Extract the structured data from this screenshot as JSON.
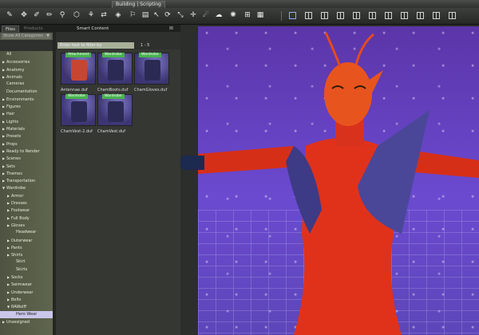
{
  "window": {
    "mode_tab": "Building | Scripting"
  },
  "toolbar": {
    "icons": [
      "pose-tool-icon",
      "universal-tool-icon",
      "node-weight-brush-icon",
      "edit-tool-icon",
      "active-pose-icon",
      "geometry-editor-icon",
      "joint-editor-icon",
      "transfer-icon",
      "surface-selection-icon",
      "region-navigator-icon",
      "script-icon",
      "pointer-icon",
      "rotate-icon",
      "scale-icon",
      "translate-icon",
      "camera-icon",
      "render-icon",
      "lights-icon",
      "aux-viewport-icon",
      "grid-icon"
    ],
    "viewport_layout_buttons": 11
  },
  "left_pane": {
    "tabs": {
      "files": "Files",
      "products": "Products",
      "smart_content": "Smart Content"
    },
    "category_select": "Show All Categories",
    "filter_placeholder": "Enter text to filter by",
    "result_count": "1 - 5",
    "categories": [
      {
        "label": "All",
        "indent": 0,
        "tri": ""
      },
      {
        "label": "Accessories",
        "indent": 0,
        "tri": "▶"
      },
      {
        "label": "Anatomy",
        "indent": 0,
        "tri": "▶"
      },
      {
        "label": "Animals",
        "indent": 0,
        "tri": "▶"
      },
      {
        "label": "Cameras",
        "indent": 0,
        "tri": ""
      },
      {
        "label": "Documentation",
        "indent": 0,
        "tri": ""
      },
      {
        "label": "Environments",
        "indent": 0,
        "tri": "▶"
      },
      {
        "label": "Figures",
        "indent": 0,
        "tri": "▶"
      },
      {
        "label": "Hair",
        "indent": 0,
        "tri": "▶"
      },
      {
        "label": "Lights",
        "indent": 0,
        "tri": "▶"
      },
      {
        "label": "Materials",
        "indent": 0,
        "tri": "▶"
      },
      {
        "label": "Presets",
        "indent": 0,
        "tri": "▶"
      },
      {
        "label": "Props",
        "indent": 0,
        "tri": "▶"
      },
      {
        "label": "Ready to Render",
        "indent": 0,
        "tri": "▶"
      },
      {
        "label": "Scenes",
        "indent": 0,
        "tri": "▶"
      },
      {
        "label": "Sets",
        "indent": 0,
        "tri": "▶"
      },
      {
        "label": "Themes",
        "indent": 0,
        "tri": "▶"
      },
      {
        "label": "Transportation",
        "indent": 0,
        "tri": "▶"
      },
      {
        "label": "Wardrobe",
        "indent": 0,
        "tri": "▼"
      },
      {
        "label": "Armor",
        "indent": 1,
        "tri": "▶"
      },
      {
        "label": "Dresses",
        "indent": 1,
        "tri": "▶"
      },
      {
        "label": "Footwear",
        "indent": 1,
        "tri": "▶"
      },
      {
        "label": "Full Body",
        "indent": 1,
        "tri": "▶"
      },
      {
        "label": "Gloves",
        "indent": 1,
        "tri": "▶"
      },
      {
        "label": "Headwear",
        "indent": 2,
        "tri": ""
      },
      {
        "label": "Outerwear",
        "indent": 1,
        "tri": "▶"
      },
      {
        "label": "Pants",
        "indent": 1,
        "tri": "▶"
      },
      {
        "label": "Shirts",
        "indent": 1,
        "tri": "▶"
      },
      {
        "label": "Skirt",
        "indent": 2,
        "tri": ""
      },
      {
        "label": "Skirts",
        "indent": 2,
        "tri": ""
      },
      {
        "label": "Socks",
        "indent": 1,
        "tri": "▶"
      },
      {
        "label": "Swimwear",
        "indent": 1,
        "tri": "▶"
      },
      {
        "label": "Underwear",
        "indent": 1,
        "tri": "▶"
      },
      {
        "label": "Belts",
        "indent": 1,
        "tri": "▶"
      },
      {
        "label": "RAWolff",
        "indent": 1,
        "tri": "▼"
      },
      {
        "label": "Hero Wear",
        "indent": 2,
        "tri": "",
        "selected": true
      },
      {
        "label": "Unassigned",
        "indent": 0,
        "tri": "▶"
      }
    ],
    "items": [
      {
        "name": "Antennae.duf",
        "badge": "Attachment",
        "color": "#c8462f"
      },
      {
        "name": "ChamBoots.duf",
        "badge": "Wardrobe",
        "color": "#2b2a55"
      },
      {
        "name": "ChamGloves.duf",
        "badge": "Wardrobe",
        "color": "#2b2a55"
      },
      {
        "name": "ChamVest-2.duf",
        "badge": "Wardrobe",
        "color": "#2b2a55"
      },
      {
        "name": "ChamVest.duf",
        "badge": "Wardrobe",
        "color": "#2b2a55"
      }
    ]
  }
}
